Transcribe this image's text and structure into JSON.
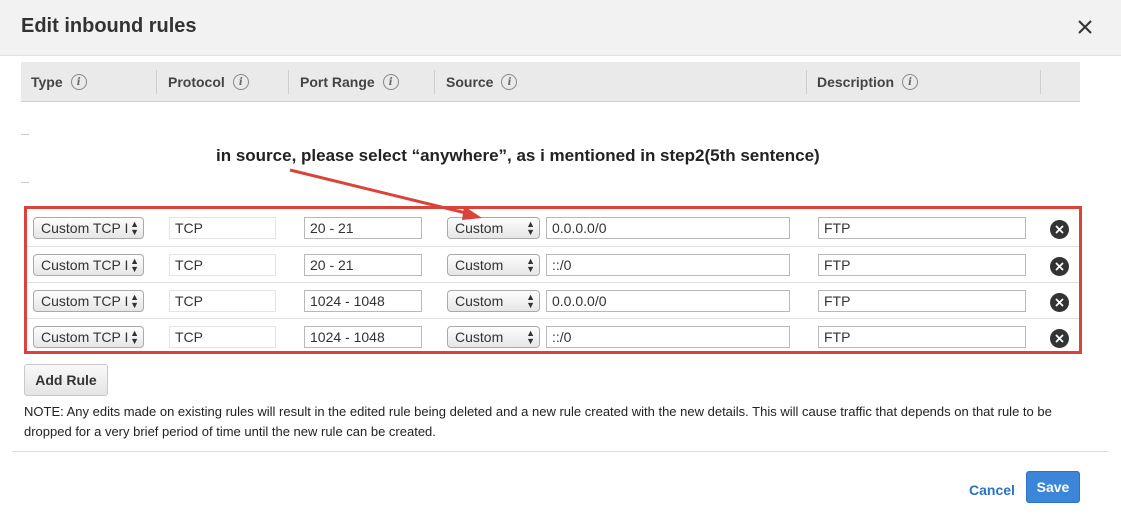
{
  "dialog": {
    "title": "Edit inbound rules",
    "close_icon": "close-icon"
  },
  "columns": [
    {
      "label": "Type",
      "info": "i"
    },
    {
      "label": "Protocol",
      "info": "i"
    },
    {
      "label": "Port Range",
      "info": "i"
    },
    {
      "label": "Source",
      "info": "i"
    },
    {
      "label": "Description",
      "info": "i"
    }
  ],
  "annotation": {
    "text": "in source, please select “anywhere”, as i mentioned in step2(5th sentence)",
    "color": "#d9433a"
  },
  "rules": [
    {
      "type": "Custom TCP I",
      "protocol": "TCP",
      "port_range": "20 - 21",
      "source_type": "Custom",
      "source": "0.0.0.0/0",
      "description": "FTP"
    },
    {
      "type": "Custom TCP I",
      "protocol": "TCP",
      "port_range": "20 - 21",
      "source_type": "Custom",
      "source": "::/0",
      "description": "FTP"
    },
    {
      "type": "Custom TCP I",
      "protocol": "TCP",
      "port_range": "1024 - 1048",
      "source_type": "Custom",
      "source": "0.0.0.0/0",
      "description": "FTP"
    },
    {
      "type": "Custom TCP I",
      "protocol": "TCP",
      "port_range": "1024 - 1048",
      "source_type": "Custom",
      "source": "::/0",
      "description": "FTP"
    }
  ],
  "actions": {
    "add_rule": "Add Rule",
    "cancel": "Cancel",
    "save": "Save"
  },
  "note": "NOTE: Any edits made on existing rules will result in the edited rule being deleted and a new rule created with the new details. This will cause traffic that depends on that rule to be dropped for a very brief period of time until the new rule can be created.",
  "colors": {
    "accent": "#3b86d8",
    "highlight": "#d9433a",
    "link": "#2a72c4"
  }
}
